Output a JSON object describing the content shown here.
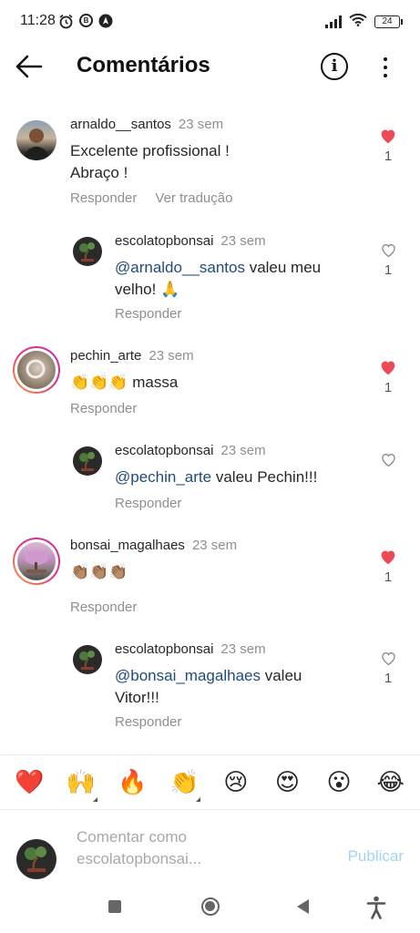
{
  "status_bar": {
    "time": "11:28",
    "battery": "24",
    "left_icons": [
      "alarm-icon",
      "b-icon",
      "navigation-icon"
    ],
    "right_icons": [
      "signal-icon",
      "wifi-icon",
      "battery-icon"
    ]
  },
  "header": {
    "title": "Comentários",
    "back_icon": "arrow-left-icon",
    "info_icon": "info-icon",
    "more_icon": "more-vertical-icon"
  },
  "comments": [
    {
      "username": "arnaldo__santos",
      "time": "23 sem",
      "text_lines": [
        "Excelente profissional !",
        "Abraço !"
      ],
      "actions": [
        "Responder",
        "Ver tradução"
      ],
      "liked": true,
      "likes": "1",
      "reply": {
        "username": "escolatopbonsai",
        "time": "23 sem",
        "mention": "@arnaldo__santos",
        "text_rest": " valeu meu",
        "text_line2": "velho! 🙏",
        "action": "Responder",
        "liked": false,
        "likes": "1"
      }
    },
    {
      "username": "pechin_arte",
      "time": "23 sem",
      "text_lines": [
        "👏👏👏 massa"
      ],
      "actions": [
        "Responder"
      ],
      "liked": true,
      "likes": "1",
      "reply": {
        "username": "escolatopbonsai",
        "time": "23 sem",
        "mention": "@pechin_arte",
        "text_rest": " valeu Pechin!!!",
        "text_line2": "",
        "action": "Responder",
        "liked": false,
        "likes": ""
      }
    },
    {
      "username": "bonsai_magalhaes",
      "time": "23 sem",
      "text_lines": [
        "👏🏽👏🏽👏🏽"
      ],
      "actions": [
        "Responder"
      ],
      "liked": true,
      "likes": "1",
      "reply": {
        "username": "escolatopbonsai",
        "time": "23 sem",
        "mention": "@bonsai_magalhaes",
        "text_rest": " valeu",
        "text_line2": "Vitor!!!",
        "action": "Responder",
        "liked": false,
        "likes": "1"
      }
    }
  ],
  "emoji_bar": [
    "❤️",
    "🙌",
    "🔥",
    "👏",
    "😢",
    "😍",
    "😮",
    "😂"
  ],
  "composer": {
    "placeholder_line1": "Comentar como",
    "placeholder_line2": "escolatopbonsai...",
    "publish_label": "Publicar"
  },
  "colors": {
    "like_red": "#ed4956",
    "mention_blue": "#1f4b7a",
    "muted": "#8e8e8e",
    "publish_disabled": "#a3d3f6"
  }
}
